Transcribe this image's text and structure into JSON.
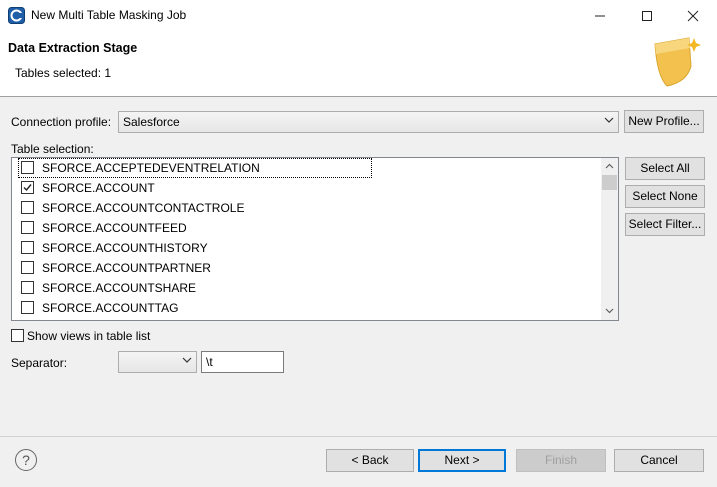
{
  "window": {
    "title": "New Multi Table Masking Job",
    "minimize": "—",
    "maximize": "☐",
    "close": "✕"
  },
  "header": {
    "stage_title": "Data Extraction Stage",
    "stage_subtitle": "Tables selected: 1"
  },
  "connection": {
    "label": "Connection profile:",
    "value": "Salesforce",
    "new_profile_button": "New Profile..."
  },
  "table_selection": {
    "label": "Table selection:",
    "rows": [
      {
        "name": "SFORCE.ACCEPTEDEVENTRELATION",
        "checked": false
      },
      {
        "name": "SFORCE.ACCOUNT",
        "checked": true
      },
      {
        "name": "SFORCE.ACCOUNTCONTACTROLE",
        "checked": false
      },
      {
        "name": "SFORCE.ACCOUNTFEED",
        "checked": false
      },
      {
        "name": "SFORCE.ACCOUNTHISTORY",
        "checked": false
      },
      {
        "name": "SFORCE.ACCOUNTPARTNER",
        "checked": false
      },
      {
        "name": "SFORCE.ACCOUNTSHARE",
        "checked": false
      },
      {
        "name": "SFORCE.ACCOUNTTAG",
        "checked": false
      }
    ],
    "select_all": "Select All",
    "select_none": "Select None",
    "select_filter": "Select Filter..."
  },
  "options": {
    "show_views_label": "Show views in table list",
    "show_views_checked": false,
    "separator_label": "Separator:",
    "separator_combo_value": "",
    "separator_text": "\\t"
  },
  "footer": {
    "back": "< Back",
    "next": "Next >",
    "finish": "Finish",
    "cancel": "Cancel"
  },
  "colors": {
    "accent": "#0078d7",
    "banner_gold": "#f2c14e"
  }
}
